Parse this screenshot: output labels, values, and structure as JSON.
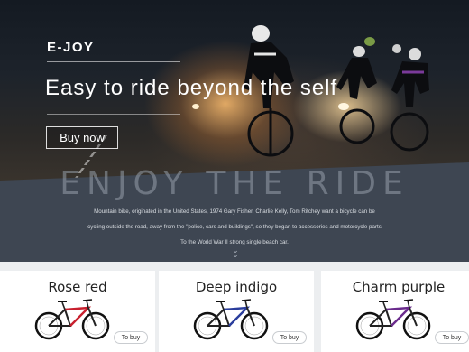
{
  "hero": {
    "brand": "E-JOY",
    "headline": "Easy to ride beyond the self",
    "cta_label": "Buy now"
  },
  "band": {
    "watermark": "ENJOY THE RIDE",
    "lines": [
      "Mountain bike, originated in the United States, 1974 Gary Fisher, Charlie Kelly, Tom Ritchey want a bicycle can be",
      "cycling outside the road, away from the \"police, cars and buildings\", so they began to accessories and motorcycle parts",
      "To the World War II strong single beach car."
    ],
    "scroll_icon": "double-chevron-down-icon"
  },
  "products": [
    {
      "name": "Rose red",
      "button": "To buy",
      "accent": "#c8202e"
    },
    {
      "name": "Deep indigo",
      "button": "To buy",
      "accent": "#2a3d9c"
    },
    {
      "name": "Charm purple",
      "button": "To buy",
      "accent": "#6a2b8c"
    }
  ]
}
